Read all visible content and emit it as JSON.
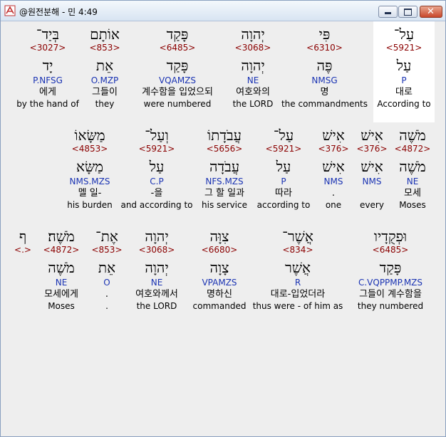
{
  "window": {
    "title": "@원전분해 - 민 4:49",
    "buttons": {
      "minimize": "minimize-icon",
      "maximize": "maximize-icon",
      "close": "close-icon"
    },
    "colors": {
      "strongs": "#8b0000",
      "morph": "#1a33b3",
      "text": "#000000"
    }
  },
  "rows": [
    {
      "words": [
        {
          "heb": "עַל־",
          "num": "<5921>",
          "lemma": "עַל",
          "morph": "P",
          "kor": "대로",
          "eng": "According to"
        },
        {
          "heb": "פִּי",
          "num": "<6310>",
          "lemma": "פֶּה",
          "morph": "NMSG",
          "kor": "명",
          "eng": "the commandments"
        },
        {
          "heb": "יְהוָה",
          "num": "<3068>",
          "lemma": "יְהוָה",
          "morph": "NE",
          "kor": "여호와의",
          "eng": "the LORD"
        },
        {
          "heb": "פָּקַד",
          "num": "<6485>",
          "lemma": "פָּקַד",
          "morph": "VQAMZS",
          "kor": "계수함을 입었으되",
          "eng": "were numbered"
        },
        {
          "heb": "אוֹתָם",
          "num": "<853>",
          "lemma": "אֵת",
          "morph": "O.MZP",
          "kor": "그들이",
          "eng": "they"
        },
        {
          "heb": "בְּיַד־",
          "num": "<3027>",
          "lemma": "יָד",
          "morph": "P.NFSG",
          "kor": "에게",
          "eng": "by the hand of"
        }
      ]
    },
    {
      "words": [
        {
          "heb": "מֹשֶׁה",
          "num": "<4872>",
          "lemma": "מֹשֶׁה",
          "morph": "NE",
          "kor": "모세",
          "eng": "Moses"
        },
        {
          "heb": "אִישׁ",
          "num": "<376>",
          "lemma": "אִישׁ",
          "morph": "NMS",
          "kor": "",
          "eng": "every"
        },
        {
          "heb": "אִישׁ",
          "num": "<376>",
          "lemma": "אִישׁ",
          "morph": "NMS",
          "kor": ".",
          "eng": "one"
        },
        {
          "heb": "עַל־",
          "num": "<5921>",
          "lemma": "עַל",
          "morph": "P",
          "kor": "따라",
          "eng": "according to"
        },
        {
          "heb": "עֲבֹדָתוֹ",
          "num": "<5656>",
          "lemma": "עֲבֹדָה",
          "morph": "NFS.MZS",
          "kor": "그 할 일과",
          "eng": "his service"
        },
        {
          "heb": "וְעַל־",
          "num": "<5921>",
          "lemma": "עַל",
          "morph": "C.P",
          "kor": "-을",
          "eng": "and according to"
        },
        {
          "heb": "מַשָּׂאוֹ",
          "num": "<4853>",
          "lemma": "מַשָּׂא",
          "morph": "NMS.MZS",
          "kor": "멜 일-",
          "eng": "his burden"
        }
      ]
    },
    {
      "words": [
        {
          "heb": "וּפְקֻדָיו",
          "num": "<6485>",
          "lemma": "פָּקַד",
          "morph": "C.VQPPMP.MZS",
          "kor": "그들이 계수함을",
          "eng": "they numbered"
        },
        {
          "heb": "אֲשֶׁר־",
          "num": "<834>",
          "lemma": "אֲשֶׁר",
          "morph": "R",
          "kor": "대로-입었더라",
          "eng": "thus were - of him as"
        },
        {
          "heb": "צִוָּה",
          "num": "<6680>",
          "lemma": "צָוָה",
          "morph": "VPAMZS",
          "kor": "명하신",
          "eng": "commanded"
        },
        {
          "heb": "יְהוָה",
          "num": "<3068>",
          "lemma": "יְהוָה",
          "morph": "NE",
          "kor": "여호와께서",
          "eng": "the LORD"
        },
        {
          "heb": "אֶת־",
          "num": "<853>",
          "lemma": "אֵת",
          "morph": "O",
          "kor": ".",
          "eng": "."
        },
        {
          "heb": "מֹשֶׁה׃",
          "num": "<4872>",
          "lemma": "מֹשֶׁה",
          "morph": "NE",
          "kor": "모세에게",
          "eng": "Moses"
        },
        {
          "heb": "ף",
          "num": "<.>",
          "lemma": "",
          "morph": "",
          "kor": "",
          "eng": ""
        }
      ]
    }
  ]
}
